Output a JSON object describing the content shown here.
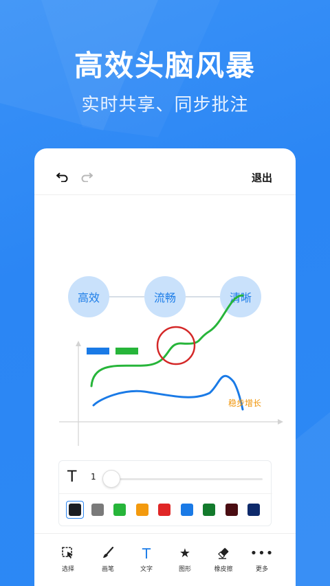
{
  "headline": "高效头脑风暴",
  "subline": "实时共享、同步批注",
  "topbar": {
    "undo_icon": "undo-icon",
    "redo_icon": "redo-icon",
    "exit_label": "退出"
  },
  "mindmap": {
    "nodes": [
      "高效",
      "流畅",
      "清晰"
    ],
    "node_color": "#c9e1fb",
    "node_text_color": "#1e7ee8"
  },
  "drawing": {
    "annotation": "稳步增长",
    "annotation_color": "#f0950a",
    "legend_colors": [
      "#1a7ae6",
      "#27b53a"
    ],
    "circle_color": "#d42828"
  },
  "text_tool": {
    "icon": "text-icon",
    "size_value": "1"
  },
  "palette": {
    "colors": [
      "#1a1d22",
      "#7a7a7a",
      "#27b53a",
      "#f39a0e",
      "#e02626",
      "#1a7ae6",
      "#137a2c",
      "#4a0d12",
      "#0e2a6b"
    ],
    "selected_index": 0
  },
  "toolbar": {
    "items": [
      {
        "label": "选择",
        "icon": "select-icon"
      },
      {
        "label": "画笔",
        "icon": "brush-icon"
      },
      {
        "label": "文字",
        "icon": "text-icon"
      },
      {
        "label": "图形",
        "icon": "shape-star-icon"
      },
      {
        "label": "橡皮擦",
        "icon": "eraser-icon"
      },
      {
        "label": "更多",
        "icon": "more-icon"
      }
    ],
    "active_index": 2,
    "accent": "#1e7ee8"
  }
}
